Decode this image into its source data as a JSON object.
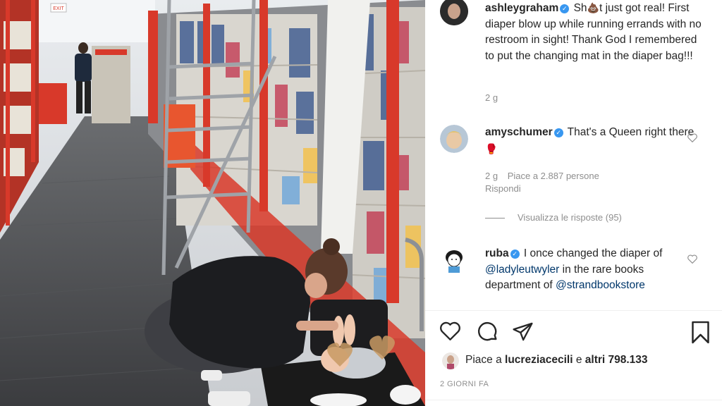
{
  "post": {
    "author": "ashleygraham",
    "caption_start": "Sh",
    "caption_emoji": "💩",
    "caption_rest": "t just got real! First diaper blow up while running errands with no restroom in sight! Thank God I remembered to put the changing mat in the diaper bag!!!",
    "caption_time": "2 g"
  },
  "comments": [
    {
      "user": "amyschumer",
      "text": "That's a Queen right there",
      "emoji": "🥊",
      "time": "2 g",
      "likes": "Piace a 2.887 persone",
      "reply": "Rispondi",
      "view_replies": "Visualizza le risposte (95)"
    },
    {
      "user": "ruba",
      "text_start": "I once changed the diaper of",
      "mention1": "@ladyleutwyler",
      "text_mid": "in the rare books department of",
      "mention2": "@strandbookstore"
    }
  ],
  "likes": {
    "prefix": "Piace a",
    "user": "lucreziacecili",
    "conj": "e",
    "others": "altri 798.133"
  },
  "timestamp": "2 GIORNI FA",
  "store_sign": "EXIT",
  "icons": [
    "verified-icon",
    "heart-icon",
    "comment-icon",
    "share-icon",
    "bookmark-icon"
  ],
  "colors": {
    "verified": "#3897f0",
    "mention": "#00376b",
    "meta": "#8e8e8e",
    "shelf_red": "#d8392a"
  }
}
